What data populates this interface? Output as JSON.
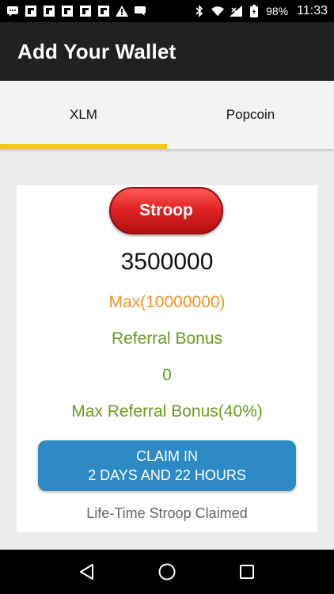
{
  "status_bar": {
    "battery": "98%",
    "time": "11:33",
    "icons": [
      "message-icon",
      "flipboard-icon",
      "flipboard-icon",
      "flipboard-icon",
      "flipboard-icon",
      "flipboard-icon",
      "alert-icon",
      "chat-icon",
      "bluetooth-icon",
      "wifi-icon",
      "signal-icon",
      "battery-icon"
    ]
  },
  "app_bar": {
    "title": "Add Your Wallet"
  },
  "tabs": [
    {
      "label": "XLM",
      "selected": true
    },
    {
      "label": "Popcoin",
      "selected": false
    }
  ],
  "card": {
    "currency_button": "Stroop",
    "amount": "3500000",
    "max_label": "Max(10000000)",
    "referral_label": "Referral Bonus",
    "referral_value": "0",
    "max_referral_label": "Max Referral Bonus(40%)",
    "claim_line1": "CLAIM IN",
    "claim_line2": "2 DAYS AND 22 HOURS",
    "lifetime_label": "Life-Time Stroop Claimed"
  },
  "nav_bar": {
    "icons": [
      "back-icon",
      "home-icon",
      "recents-icon"
    ]
  },
  "colors": {
    "accent_yellow": "#f5c518",
    "orange": "#f59222",
    "green": "#6b9a1d",
    "claim_blue": "#2d8ac4",
    "stroop_red": "#e22424"
  }
}
